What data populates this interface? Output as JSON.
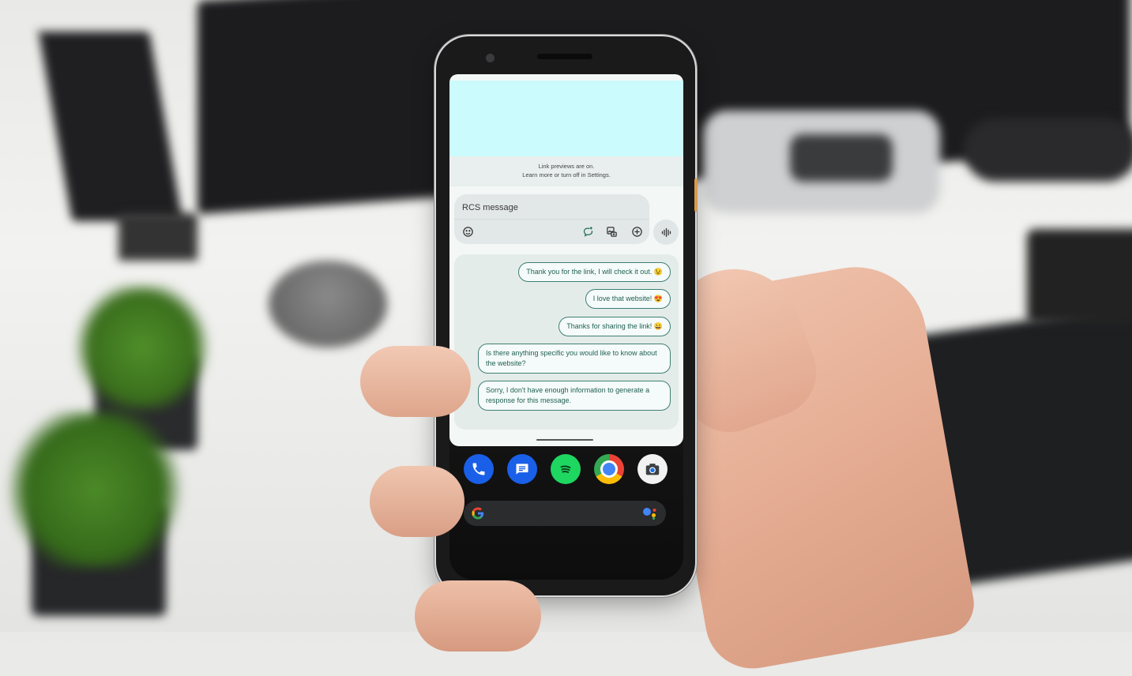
{
  "link_preview": {
    "image_color": "#cbfbfc",
    "notice_line1": "Link previews are on.",
    "notice_line2": "Learn more or turn off in Settings."
  },
  "compose": {
    "placeholder": "RCS message",
    "value": "",
    "icons": [
      "emoji-icon",
      "magic-compose-icon",
      "gallery-icon",
      "add-icon"
    ],
    "voice_icon": "voice-waveform-icon"
  },
  "messages": [
    {
      "text": "Thank you for the link, I will check it out. 😉"
    },
    {
      "text": "I love that website! 😍"
    },
    {
      "text": "Thanks for sharing the link! 😀"
    },
    {
      "text": "Is there anything specific you would like to know about the website?"
    },
    {
      "text": "Sorry, I don't have enough information to generate a response for this message."
    }
  ],
  "dock": {
    "apps": [
      {
        "name": "Phone",
        "color": "#1a5fe8"
      },
      {
        "name": "Messages",
        "color": "#1a5fe8"
      },
      {
        "name": "Spotify",
        "color": "#1ed760"
      },
      {
        "name": "Chrome",
        "color": "#4285f4"
      },
      {
        "name": "Camera",
        "color": "#f2f2f2"
      }
    ]
  },
  "search_bar": {
    "logo": "google-g-icon",
    "assistant": "google-assistant-icon"
  },
  "colors": {
    "bubble_border": "#3f7f73",
    "bubble_text": "#1f5f53",
    "sheet_bg": "#f3f7f6"
  }
}
